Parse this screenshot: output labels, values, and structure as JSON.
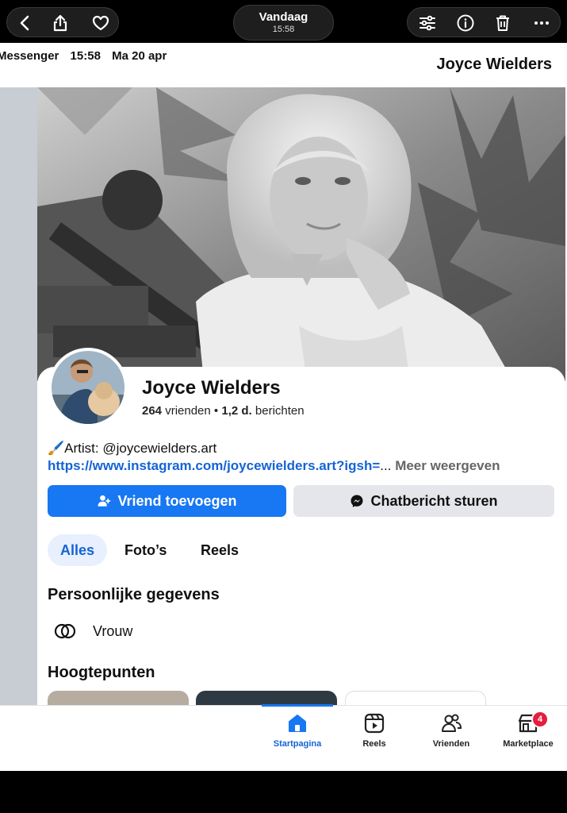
{
  "viewer": {
    "date_title": "Vandaag",
    "date_time": "15:58"
  },
  "header": {
    "app": "Messenger",
    "time": "15:58",
    "date": "Ma 20 apr",
    "profile_name": "Joyce Wielders"
  },
  "profile": {
    "name": "Joyce Wielders",
    "friends_count": "264",
    "friends_label": "vrienden",
    "separator": "•",
    "posts_count": "1,2 d.",
    "posts_label": "berichten",
    "bio_emoji": "🖌️",
    "bio_text": "Artist: @joycewielders.art",
    "bio_link": "https://www.instagram.com/joycewielders.art?igsh=",
    "bio_ellipsis": "...",
    "bio_more": "Meer weergeven"
  },
  "actions": {
    "add_friend": "Vriend toevoegen",
    "send_message": "Chatbericht sturen"
  },
  "tabs": [
    {
      "label": "Alles",
      "active": true
    },
    {
      "label": "Foto’s",
      "active": false
    },
    {
      "label": "Reels",
      "active": false
    }
  ],
  "personal": {
    "title": "Persoonlijke gegevens",
    "gender": "Vrouw"
  },
  "highlights": {
    "title": "Hoogtepunten"
  },
  "bottom_nav": [
    {
      "label": "Startpagina",
      "icon": "home-icon",
      "active": true
    },
    {
      "label": "Reels",
      "icon": "reels-icon",
      "active": false
    },
    {
      "label": "Vrienden",
      "icon": "friends-icon",
      "active": false
    },
    {
      "label": "Marketplace",
      "icon": "marketplace-icon",
      "active": false,
      "badge": "4"
    }
  ],
  "colors": {
    "accent": "#1877f2",
    "link": "#1463d6",
    "badge": "#e41e3f"
  }
}
